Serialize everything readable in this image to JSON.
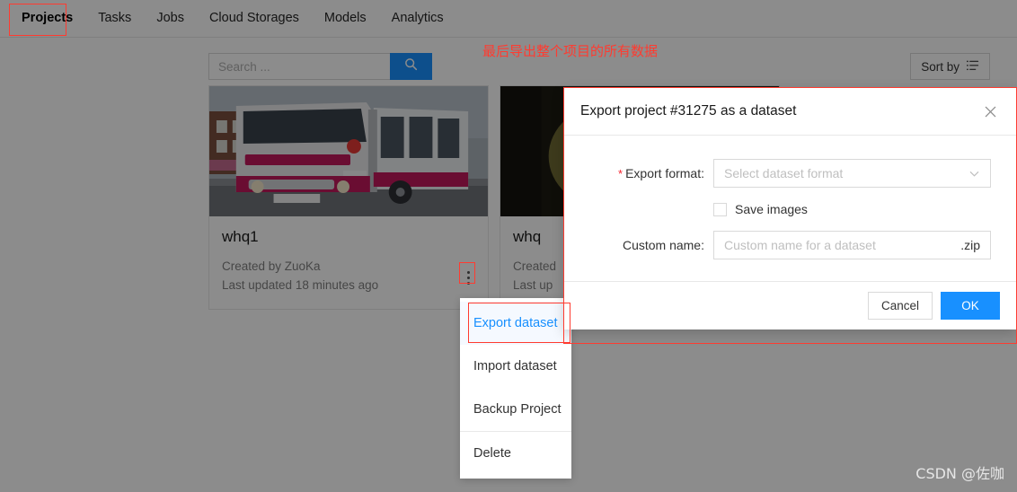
{
  "nav": {
    "items": [
      {
        "label": "Projects",
        "active": true
      },
      {
        "label": "Tasks",
        "active": false
      },
      {
        "label": "Jobs",
        "active": false
      },
      {
        "label": "Cloud Storages",
        "active": false
      },
      {
        "label": "Models",
        "active": false
      },
      {
        "label": "Analytics",
        "active": false
      }
    ]
  },
  "toolbar": {
    "search_placeholder": "Search ...",
    "search_value": "",
    "search_icon": "search-icon",
    "sort_label": "Sort by",
    "sort_icon": "sort-list-icon"
  },
  "cards": [
    {
      "title": "whq1",
      "created_by": "Created by ZuoKa",
      "updated": "Last updated 18 minutes ago",
      "menu_icon": "more-vertical-icon"
    },
    {
      "title": "whq",
      "created_by": "Created",
      "updated": "Last up",
      "menu_icon": "more-vertical-icon"
    }
  ],
  "context_menu": {
    "items": [
      {
        "label": "Export dataset",
        "selected": true,
        "divider_after": false
      },
      {
        "label": "Import dataset",
        "selected": false,
        "divider_after": false
      },
      {
        "label": "Backup Project",
        "selected": false,
        "divider_after": true
      },
      {
        "label": "Delete",
        "selected": false,
        "divider_after": false
      }
    ]
  },
  "dialog": {
    "title": "Export project #31275 as a dataset",
    "close_icon": "close-icon",
    "format": {
      "label": "Export format:",
      "required": true,
      "placeholder": "Select dataset format",
      "value": "",
      "caret_icon": "chevron-down-icon"
    },
    "save_images": {
      "label": "Save images",
      "checked": false
    },
    "custom_name": {
      "label": "Custom name:",
      "placeholder": "Custom name for a dataset",
      "value": "",
      "suffix": ".zip"
    },
    "cancel_label": "Cancel",
    "ok_label": "OK"
  },
  "annotation": {
    "note": "最后导出整个项目的所有数据",
    "color": "#ff3b30"
  },
  "watermark": {
    "text": "CSDN @佐咖"
  },
  "colors": {
    "accent": "#1890ff",
    "annotation_red": "#ff3b30",
    "required_red": "#f5222d",
    "menu_selected_bg": "#f5f9ff"
  }
}
